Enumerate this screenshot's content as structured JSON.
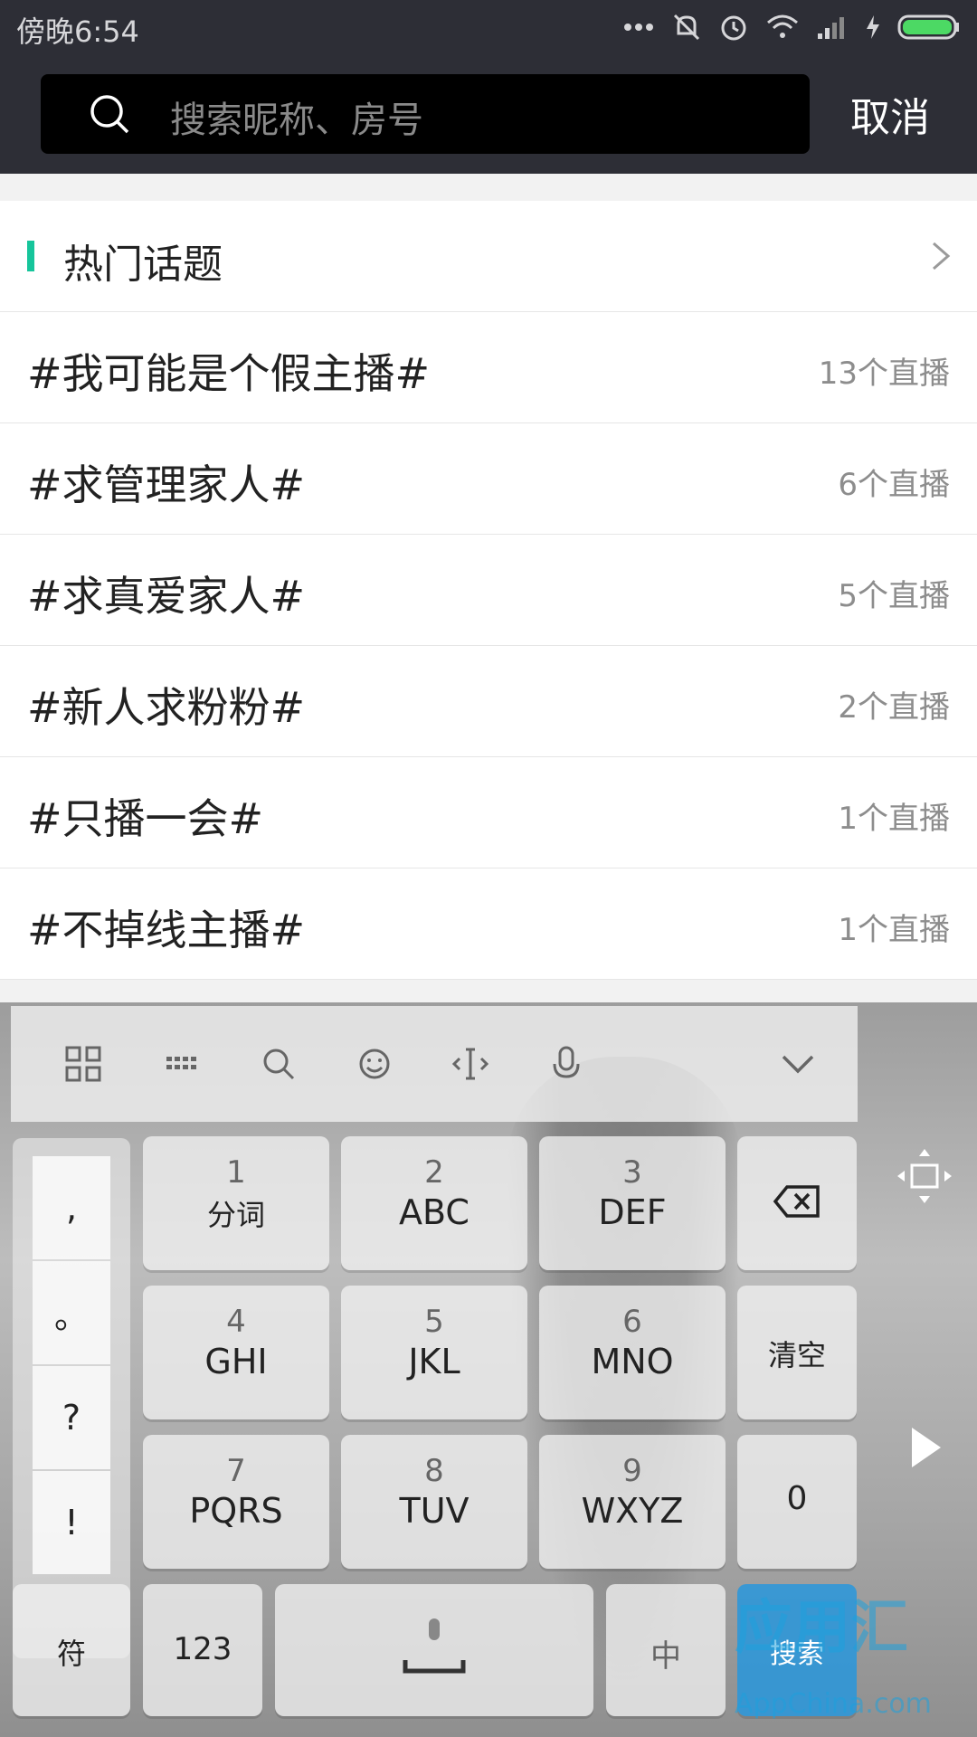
{
  "status": {
    "time": "傍晚6:54"
  },
  "search": {
    "placeholder": "搜索昵称、房号",
    "cancel": "取消"
  },
  "section": {
    "title": "热门话题"
  },
  "topics": [
    {
      "name": "#我可能是个假主播#",
      "count": "13个直播"
    },
    {
      "name": "#求管理家人#",
      "count": "6个直播"
    },
    {
      "name": "#求真爱家人#",
      "count": "5个直播"
    },
    {
      "name": "#新人求粉粉#",
      "count": "2个直播"
    },
    {
      "name": "#只播一会#",
      "count": "1个直播"
    },
    {
      "name": "#不掉线主播#",
      "count": "1个直播"
    }
  ],
  "keyboard": {
    "punct": [
      ",",
      "。",
      "?",
      "!"
    ],
    "keys": [
      {
        "num": "1",
        "label": "分词"
      },
      {
        "num": "2",
        "label": "ABC"
      },
      {
        "num": "3",
        "label": "DEF"
      },
      {
        "num": "4",
        "label": "GHI"
      },
      {
        "num": "5",
        "label": "JKL"
      },
      {
        "num": "6",
        "label": "MNO"
      },
      {
        "num": "7",
        "label": "PQRS"
      },
      {
        "num": "8",
        "label": "TUV"
      },
      {
        "num": "9",
        "label": "WXYZ"
      }
    ],
    "clear": "清空",
    "zero": "0",
    "symbols": "符",
    "numbers": "123",
    "lang": "中",
    "search": "搜索"
  },
  "watermark": {
    "big": "应用汇",
    "small": "AppChina.com"
  },
  "colors": {
    "accent": "#16c59b",
    "topbar": "#2d2e36"
  }
}
